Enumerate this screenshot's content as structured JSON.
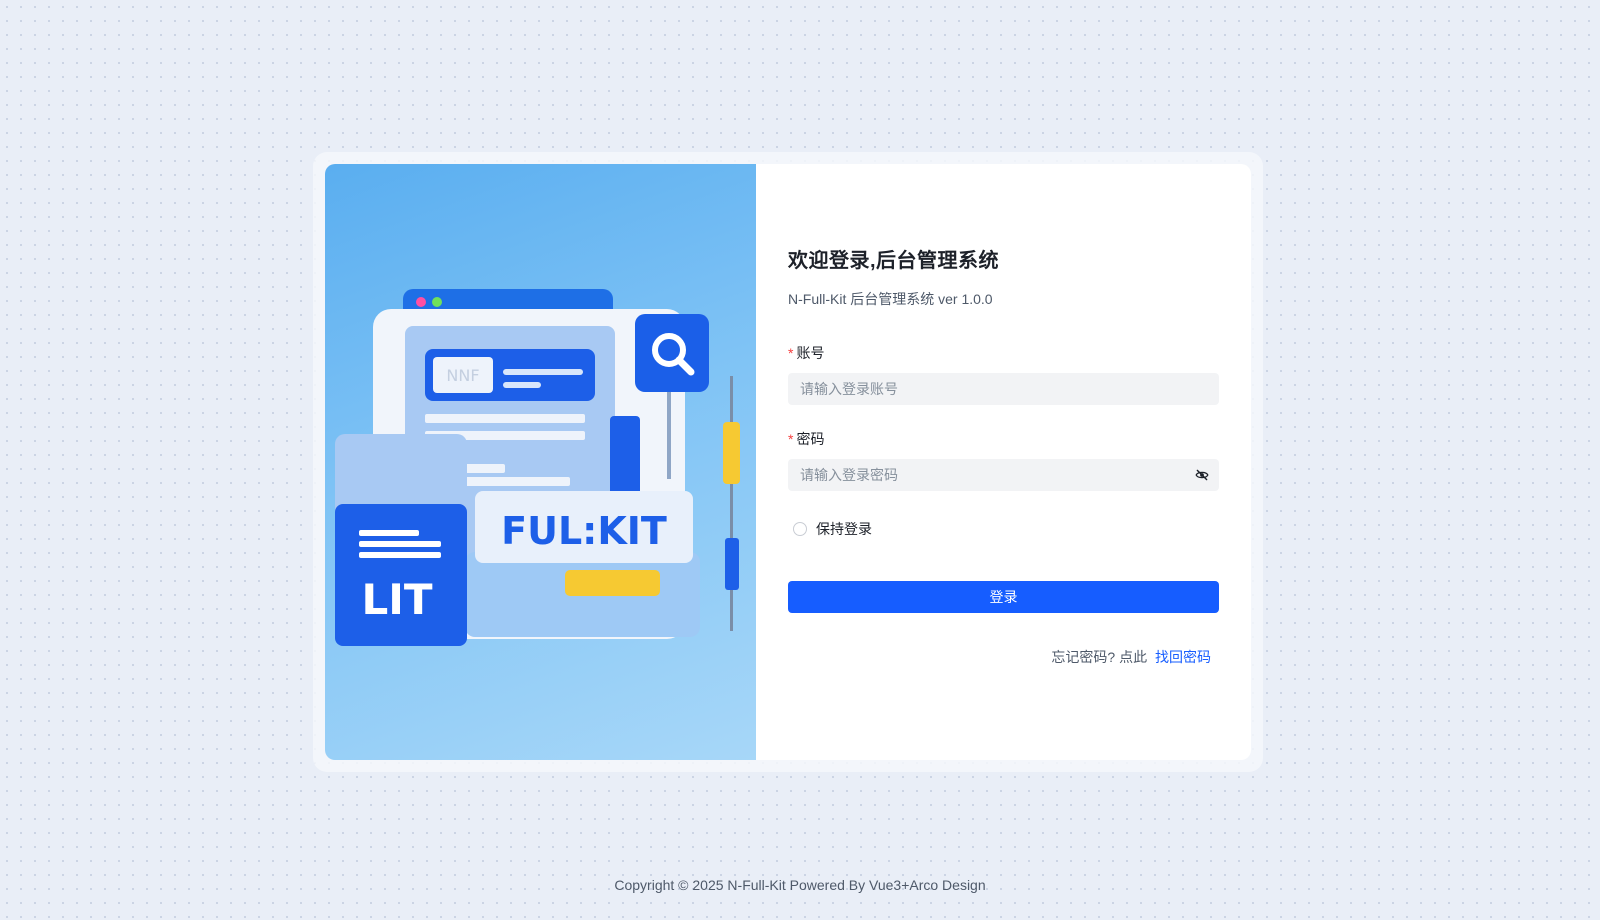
{
  "login": {
    "title": "欢迎登录,后台管理系统",
    "subtitle": "N-Full-Kit 后台管理系统 ver 1.0.0",
    "account_label": "账号",
    "account_placeholder": "请输入登录账号",
    "password_label": "密码",
    "password_placeholder": "请输入登录密码",
    "required_mark": "*",
    "remember_label": "保持登录",
    "remember_checked": false,
    "login_button": "登录",
    "forgot_prefix": "忘记密码? 点此",
    "forgot_link": "找回密码"
  },
  "hero": {
    "brand_text": "FUL:KIT",
    "side_text": "LIT",
    "badge_text": "NNF"
  },
  "footer": {
    "copyright": "Copyright © 2025 N-Full-Kit Powered By Vue3+Arco Design"
  },
  "colors": {
    "primary": "#165dff",
    "required": "#f53f3f",
    "text": "#1d2129",
    "secondary_text": "#4e5969",
    "input_bg": "#f2f3f5"
  },
  "icons": {
    "password_toggle": "eye-off-icon",
    "search": "search-icon"
  }
}
